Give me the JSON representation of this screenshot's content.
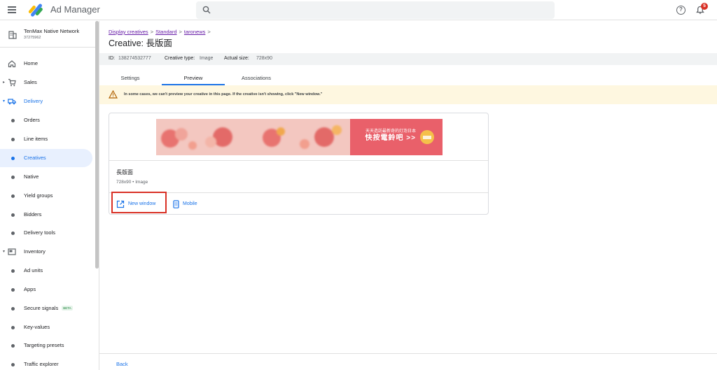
{
  "app": {
    "name": "Ad Manager",
    "notification_count": "5"
  },
  "network": {
    "name": "TenMax Native Network",
    "id": "37275962"
  },
  "sidebar": {
    "items": [
      {
        "label": "Home"
      },
      {
        "label": "Sales"
      },
      {
        "label": "Delivery"
      },
      {
        "label": "Orders"
      },
      {
        "label": "Line items"
      },
      {
        "label": "Creatives"
      },
      {
        "label": "Native"
      },
      {
        "label": "Yield groups"
      },
      {
        "label": "Bidders"
      },
      {
        "label": "Delivery tools"
      },
      {
        "label": "Inventory"
      },
      {
        "label": "Ad units"
      },
      {
        "label": "Apps"
      },
      {
        "label": "Secure signals",
        "badge": "BETA"
      },
      {
        "label": "Key-values"
      },
      {
        "label": "Targeting presets"
      },
      {
        "label": "Traffic explorer"
      }
    ]
  },
  "breadcrumb": {
    "items": [
      "Display creatives",
      "Standard",
      "taronews"
    ],
    "separator": ">"
  },
  "page": {
    "title": "Creative: 長版面"
  },
  "info": {
    "id_label": "ID:",
    "id_value": "138274532777",
    "type_label": "Creative type:",
    "type_value": "Image",
    "size_label": "Actual size:",
    "size_value": "728x90"
  },
  "tabs": [
    {
      "label": "Settings"
    },
    {
      "label": "Preview"
    },
    {
      "label": "Associations"
    }
  ],
  "warning": {
    "message": "In some cases, we can't preview your creative in this page. If the creative isn't showing, click \"New window.\""
  },
  "creative": {
    "name": "長版面",
    "meta": "728x90 • Image",
    "banner_line1": "天天造訪最新奇的灯泡日本",
    "banner_line2": "快按電鈴吧 >>"
  },
  "actions": {
    "new_window": "New window",
    "mobile": "Mobile"
  },
  "footer": {
    "back": "Back"
  },
  "colors": {
    "accent": "#1a73e8",
    "highlight": "#d93025",
    "warning_bg": "#fef7e0",
    "banner_bg": "#e9606a"
  }
}
